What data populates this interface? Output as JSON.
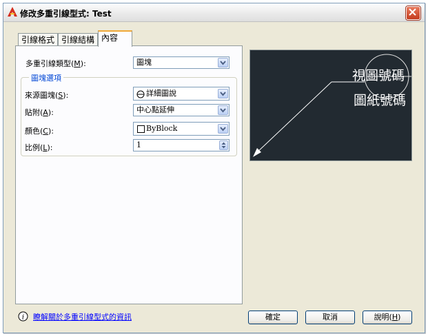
{
  "window": {
    "title": "修改多重引線型式: Test"
  },
  "tabs": [
    {
      "label": "引線格式"
    },
    {
      "label": "引線結構"
    },
    {
      "label": "內容"
    }
  ],
  "content": {
    "type_label": "多重引線類型(",
    "type_key": "M",
    "type_suffix": "):",
    "type_value": "圖塊"
  },
  "block_options": {
    "title": "圖塊選項",
    "source_label": "來源圖塊(",
    "source_key": "S",
    "source_suffix": "):",
    "source_value": "詳細圖說",
    "attach_label": "貼附(",
    "attach_key": "A",
    "attach_suffix": "):",
    "attach_value": "中心點延伸",
    "color_label": "顏色(",
    "color_key": "C",
    "color_suffix": "):",
    "color_value": "ByBlock",
    "scale_label": "比例(",
    "scale_key": "L",
    "scale_suffix": "):",
    "scale_value": "1"
  },
  "preview": {
    "line1": "視圖號碼",
    "line2": "圖紙號碼"
  },
  "footer": {
    "info_link": "瞭解關於多重引線型式的資訊",
    "ok_label": "確定",
    "cancel_label": "取消",
    "help_label": "說明(",
    "help_key": "H",
    "help_suffix": ")"
  },
  "colors": {
    "preview_bg": "#222a31",
    "accent_tab": "#f0a838",
    "link": "#0000ff",
    "group_title": "#0046d5"
  }
}
